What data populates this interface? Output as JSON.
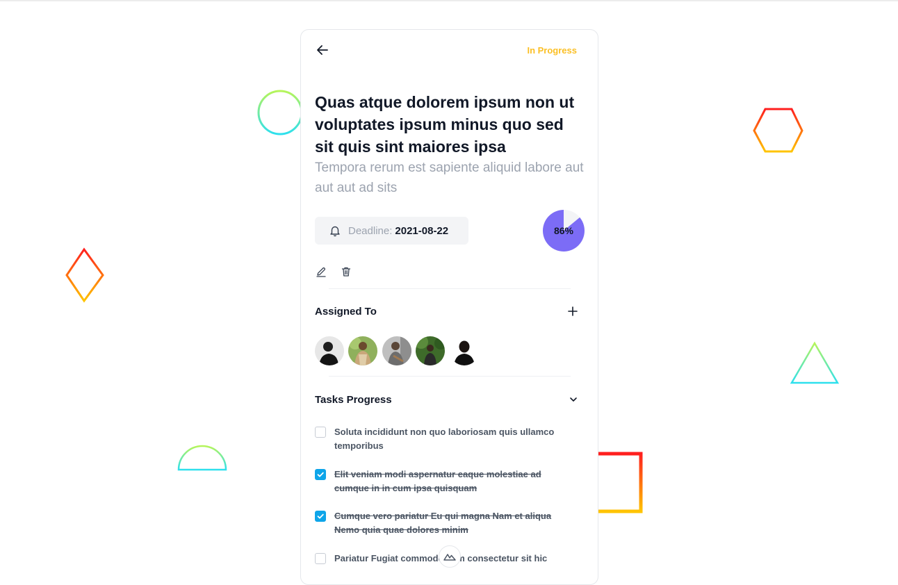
{
  "header": {
    "back_icon": "arrow-left-icon",
    "status": "In Progress"
  },
  "project": {
    "title": "Quas atque dolorem ipsum non ut voluptates ipsum minus quo sed sit quis sint maiores ipsa",
    "description": "Tempora rerum est sapiente aliquid labore aut aut aut ad sits",
    "deadline_label": "Deadline:",
    "deadline_value": "2021-08-22",
    "progress_text": "86%",
    "progress_value": 86
  },
  "actions": {
    "edit_icon": "pencil-icon",
    "delete_icon": "trash-icon"
  },
  "assigned": {
    "title": "Assigned To",
    "add_icon": "plus-icon",
    "avatar_count": 5
  },
  "tasks": {
    "title": "Tasks Progress",
    "toggle_icon": "chevron-down-icon",
    "items": [
      {
        "text": "Soluta incididunt non quo laboriosam quis ullamco temporibus",
        "done": false
      },
      {
        "text": "Elit veniam modi aspernatur eaque molestiae ad cumque in in cum ipsa quisquam",
        "done": true
      },
      {
        "text": "Cumque vero pariatur Eu qui magna Nam et aliqua Nemo quia quae dolores minim",
        "done": true
      },
      {
        "text": "Pariatur Fugiat commodo nam consectetur sit hic",
        "done": false
      }
    ]
  },
  "colors": {
    "status": "#fbbf24",
    "progress": "#7c6cf6",
    "checkbox": "#0ea5e9"
  }
}
